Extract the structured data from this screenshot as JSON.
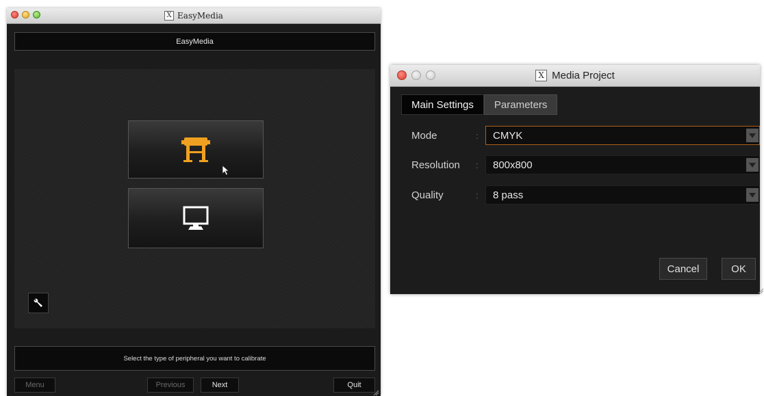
{
  "easymedia_window": {
    "title": "EasyMedia",
    "header": "EasyMedia",
    "devices": [
      {
        "name": "Printer",
        "icon": "printer-icon",
        "color": "#f0a020",
        "selected": true
      },
      {
        "name": "Monitor",
        "icon": "monitor-icon",
        "color": "#ffffff"
      }
    ],
    "status": "Select the type of peripheral you want to calibrate",
    "buttons": {
      "menu": "Menu",
      "previous": "Previous",
      "next": "Next",
      "quit": "Quit"
    }
  },
  "media_project_window": {
    "title": "Media Project",
    "tabs": [
      {
        "label": "Main Settings",
        "active": true
      },
      {
        "label": "Parameters",
        "active": false
      }
    ],
    "fields": [
      {
        "label": "Mode",
        "value": "CMYK",
        "focused": true
      },
      {
        "label": "Resolution",
        "value": "800x800"
      },
      {
        "label": "Quality",
        "value": "8 pass"
      }
    ],
    "separator": ":",
    "buttons": {
      "cancel": "Cancel",
      "ok": "OK"
    }
  },
  "colors": {
    "accent_orange": "#f0a020",
    "focus_border": "#b0601c",
    "panel_bg": "#1b1b1b"
  }
}
